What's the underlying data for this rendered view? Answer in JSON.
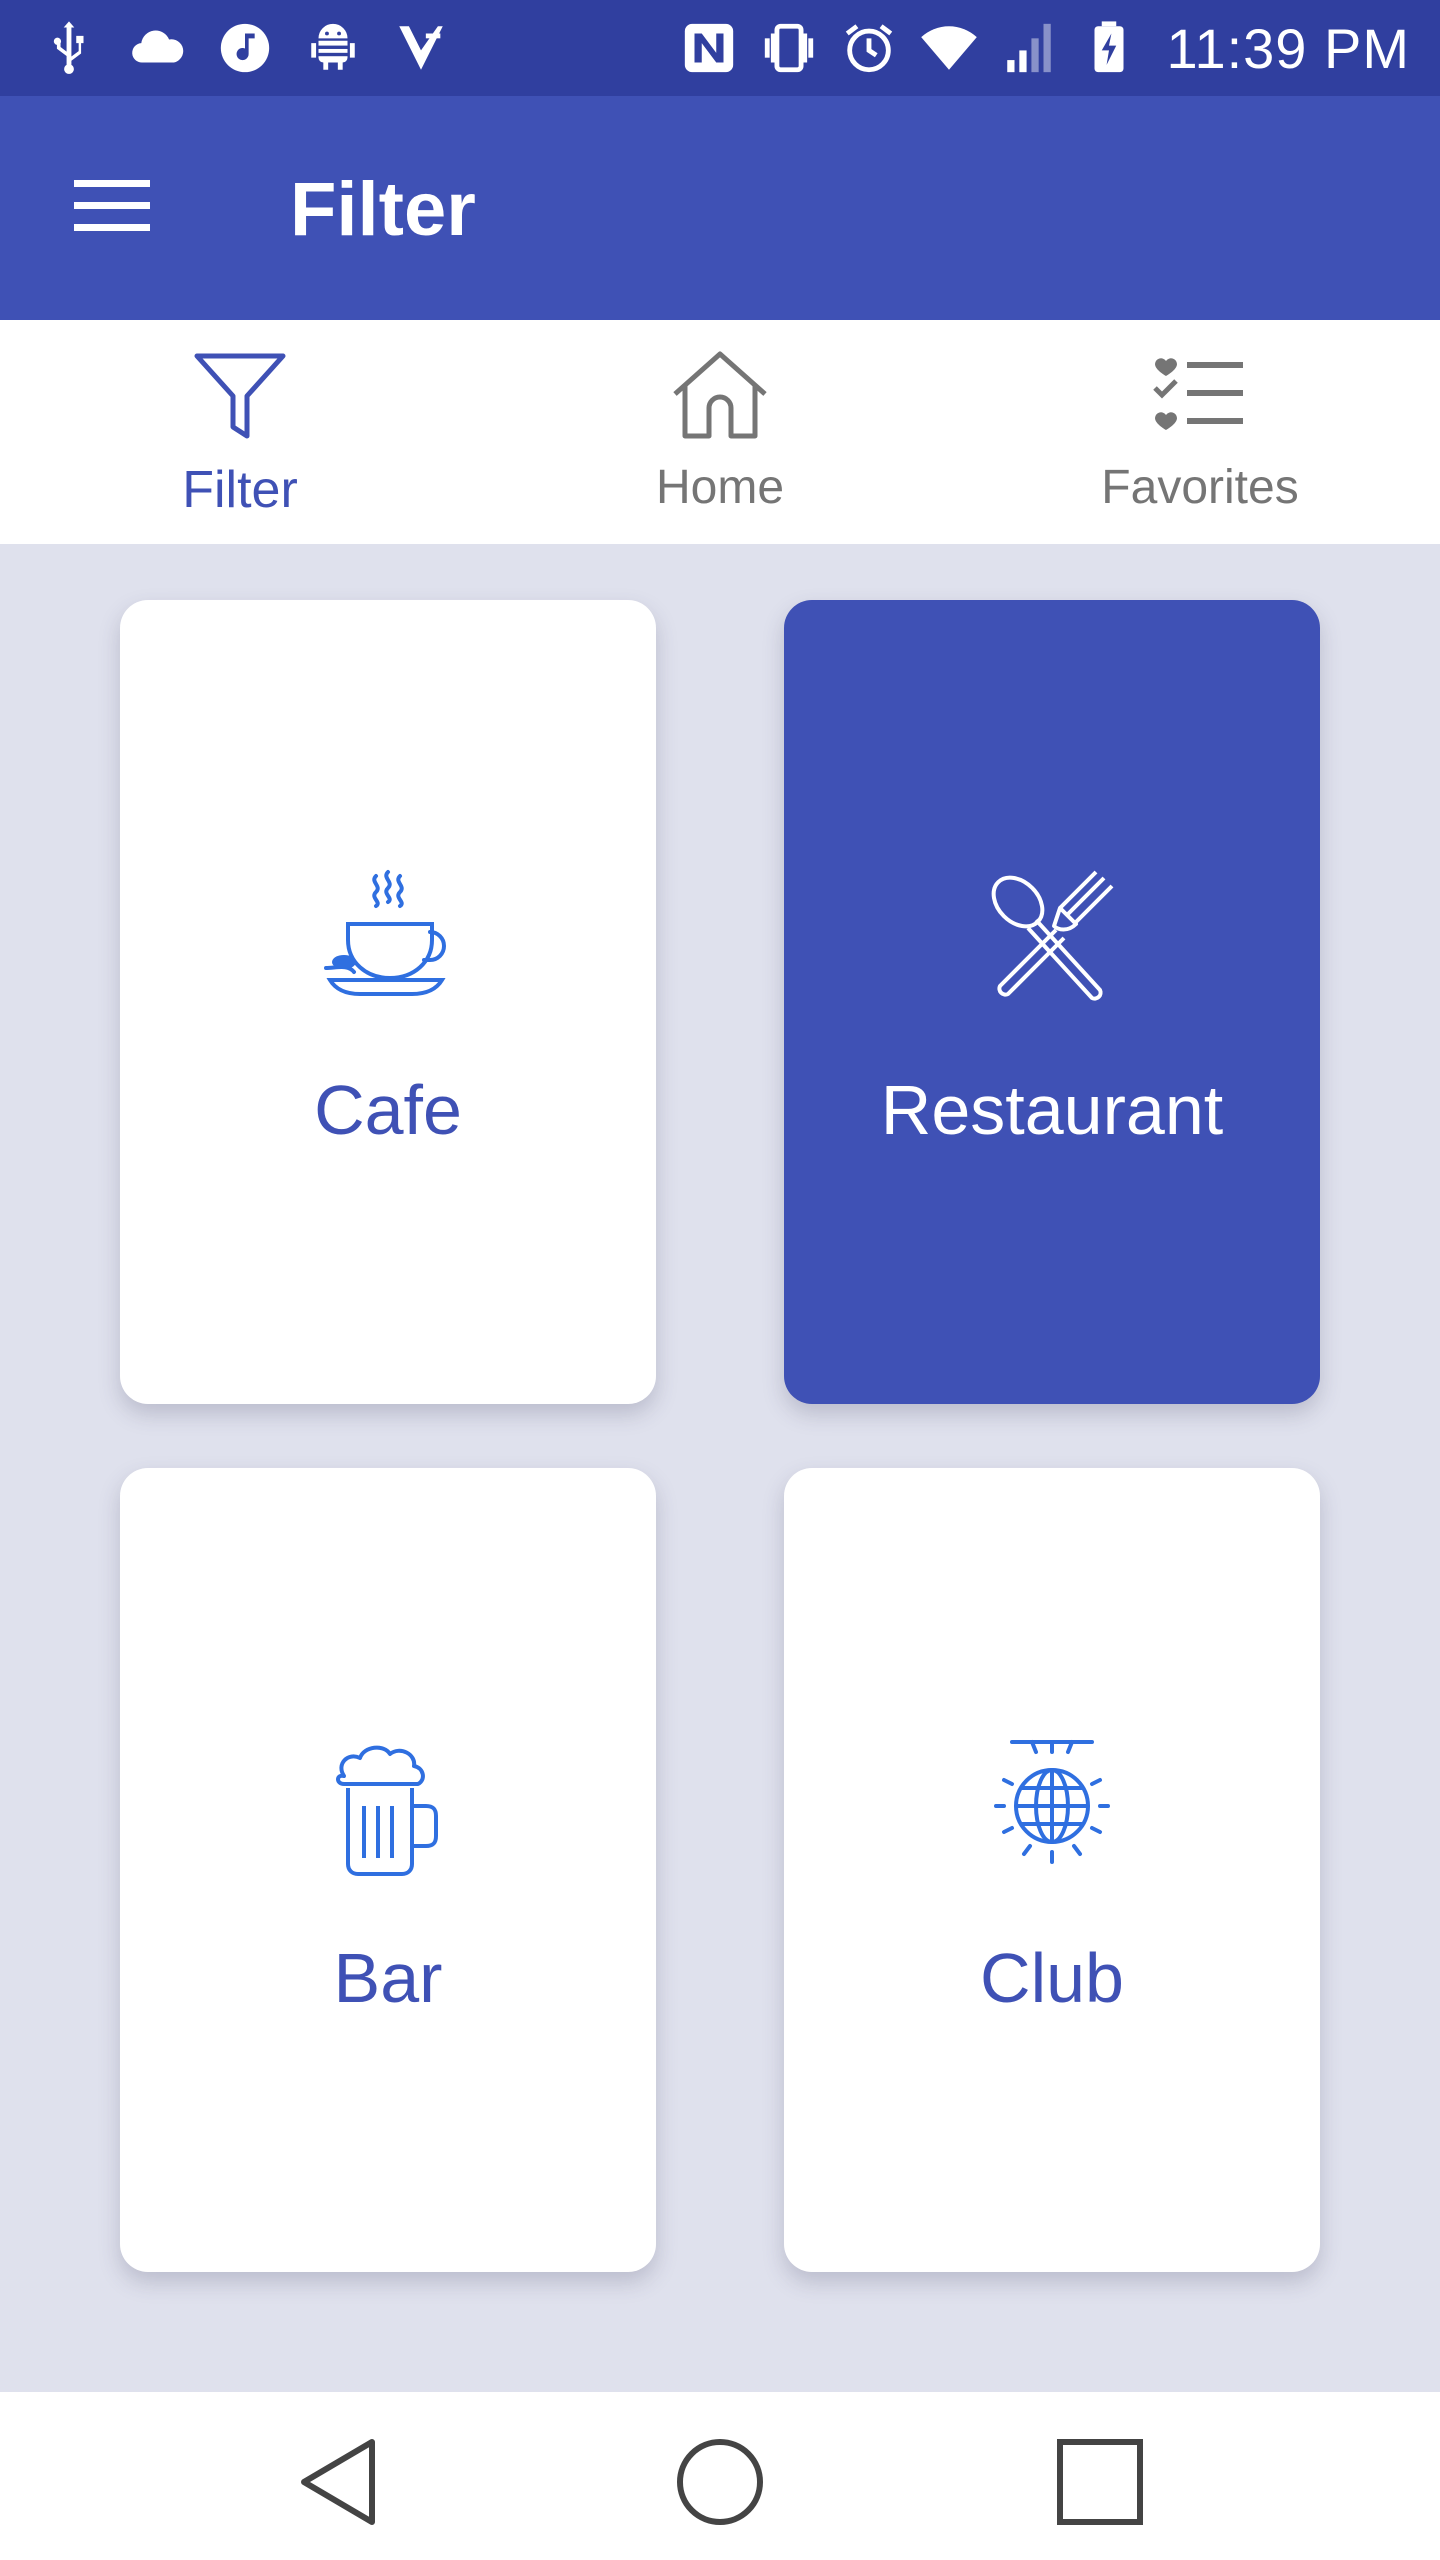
{
  "status_bar": {
    "time": "11:39 PM",
    "left_icons": [
      "usb-icon",
      "cloud-icon",
      "music-icon",
      "android-icon",
      "check-app-icon"
    ],
    "right_icons": [
      "nfc-icon",
      "vibrate-icon",
      "alarm-icon",
      "wifi-icon",
      "signal-icon",
      "battery-charging-icon"
    ]
  },
  "app_bar": {
    "title": "Filter",
    "menu_icon": "hamburger-menu-icon"
  },
  "tabs": [
    {
      "label": "Filter",
      "icon": "filter-funnel-icon",
      "active": true
    },
    {
      "label": "Home",
      "icon": "home-icon",
      "active": false
    },
    {
      "label": "Favorites",
      "icon": "favorites-list-icon",
      "active": false
    }
  ],
  "categories": [
    {
      "label": "Cafe",
      "icon": "coffee-cup-icon",
      "selected": false
    },
    {
      "label": "Restaurant",
      "icon": "spoon-fork-icon",
      "selected": true
    },
    {
      "label": "Bar",
      "icon": "beer-mug-icon",
      "selected": false
    },
    {
      "label": "Club",
      "icon": "disco-ball-icon",
      "selected": false
    }
  ],
  "nav_bar": {
    "icons": [
      "back-triangle-icon",
      "home-circle-icon",
      "recents-square-icon"
    ]
  },
  "colors": {
    "status_bar": "#303f9f",
    "primary": "#3f51b5",
    "background": "#dfe1ed",
    "icon_blue": "#2f6fe0",
    "inactive": "#757575"
  }
}
